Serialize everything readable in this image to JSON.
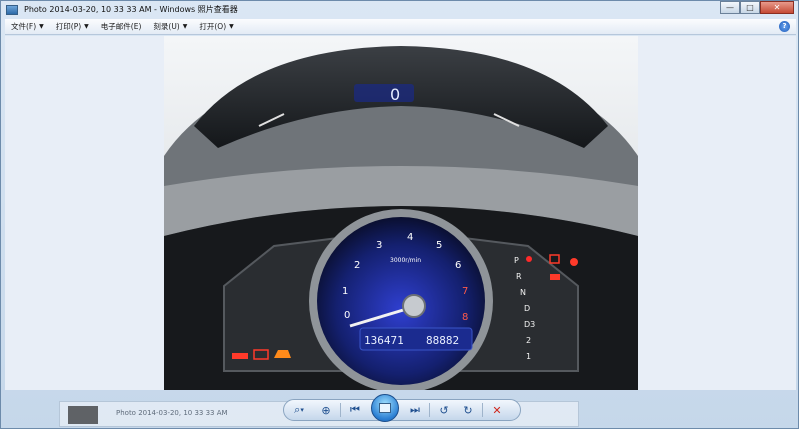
{
  "window": {
    "title": "Photo 2014-03-20, 10 33 33 AM - Windows 照片查看器",
    "min_label": "—",
    "max_label": "□",
    "close_label": "✕"
  },
  "menu": {
    "items": [
      {
        "label": "文件(F)",
        "caret": "▼"
      },
      {
        "label": "打印(P)",
        "caret": "▼"
      },
      {
        "label": "电子邮件(E)",
        "caret": ""
      },
      {
        "label": "刻录(U)",
        "caret": "▼"
      },
      {
        "label": "打开(O)",
        "caret": "▼"
      }
    ],
    "help_label": "?"
  },
  "photo": {
    "rpm_label": "3000r/min",
    "odometer": "136471",
    "trip": "88882",
    "speed_digit": "0",
    "tach_ticks": [
      "0",
      "1",
      "2",
      "3",
      "4",
      "5",
      "6",
      "7",
      "8"
    ],
    "gear_letters": [
      "P",
      "R",
      "N",
      "D",
      "D3",
      "2",
      "1"
    ]
  },
  "background": {
    "ghost_title": "Photo 2014-03-20, 10 33 33 AM"
  },
  "toolbar": {
    "zoom_icon": "⌕",
    "zoom_caret": "▾",
    "actual_size_icon": "⊕",
    "prev_icon": "⏮",
    "slideshow_icon": "slideshow-icon",
    "next_icon": "⏭",
    "rotate_ccw_icon": "↺",
    "rotate_cw_icon": "↻",
    "delete_icon": "✕"
  }
}
